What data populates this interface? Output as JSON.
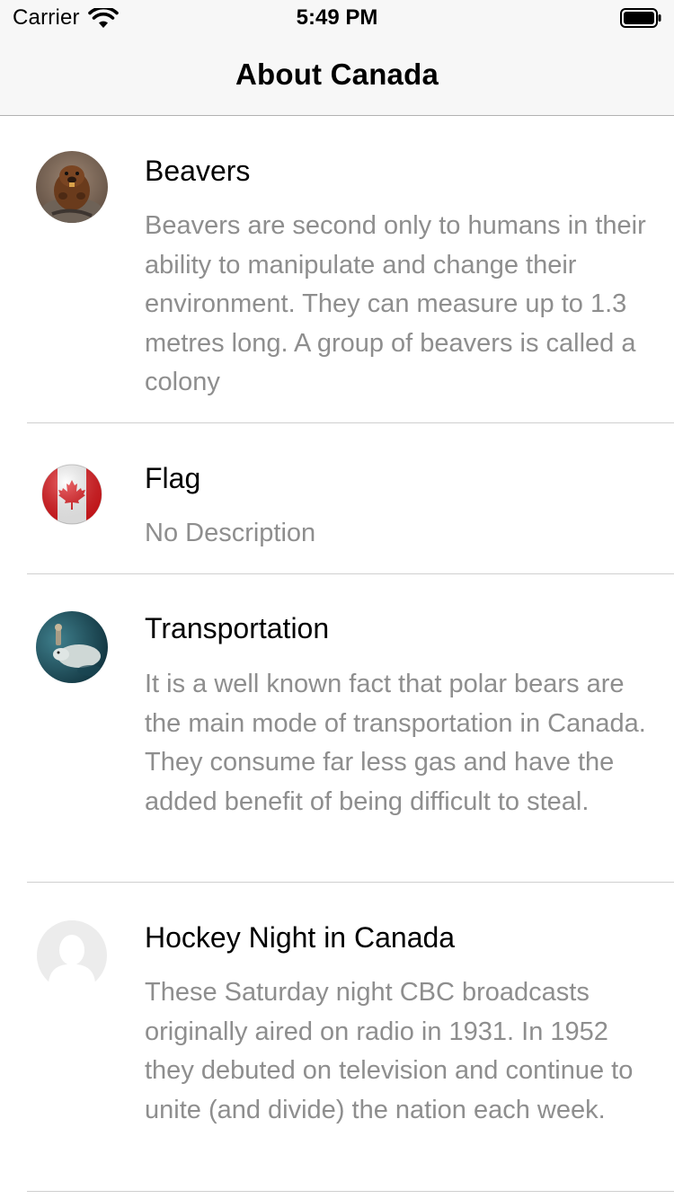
{
  "status_bar": {
    "carrier": "Carrier",
    "time": "5:49 PM"
  },
  "nav": {
    "title": "About Canada"
  },
  "rows": [
    {
      "title": "Beavers",
      "description": "Beavers are second only to humans in their ability to manipulate and change their environment. They can measure up to 1.3 metres long. A group of beavers is called a colony",
      "image": "beaver-photo"
    },
    {
      "title": "Flag",
      "description": "No Description",
      "image": "canada-flag"
    },
    {
      "title": "Transportation",
      "description": "It is a well known fact that polar bears are the main mode of transportation in Canada. They consume far less gas and have the added benefit of being difficult to steal.",
      "image": "polar-bear-photo"
    },
    {
      "title": "Hockey Night in Canada",
      "description": "These Saturday night CBC broadcasts originally aired on radio in 1931. In 1952 they debuted on television and continue to unite (and divide) the nation each week.",
      "image": "placeholder-avatar"
    }
  ],
  "colors": {
    "nav_background": "#f7f7f7",
    "description_text": "#8e8e8e",
    "separator": "#cfcfcf"
  }
}
